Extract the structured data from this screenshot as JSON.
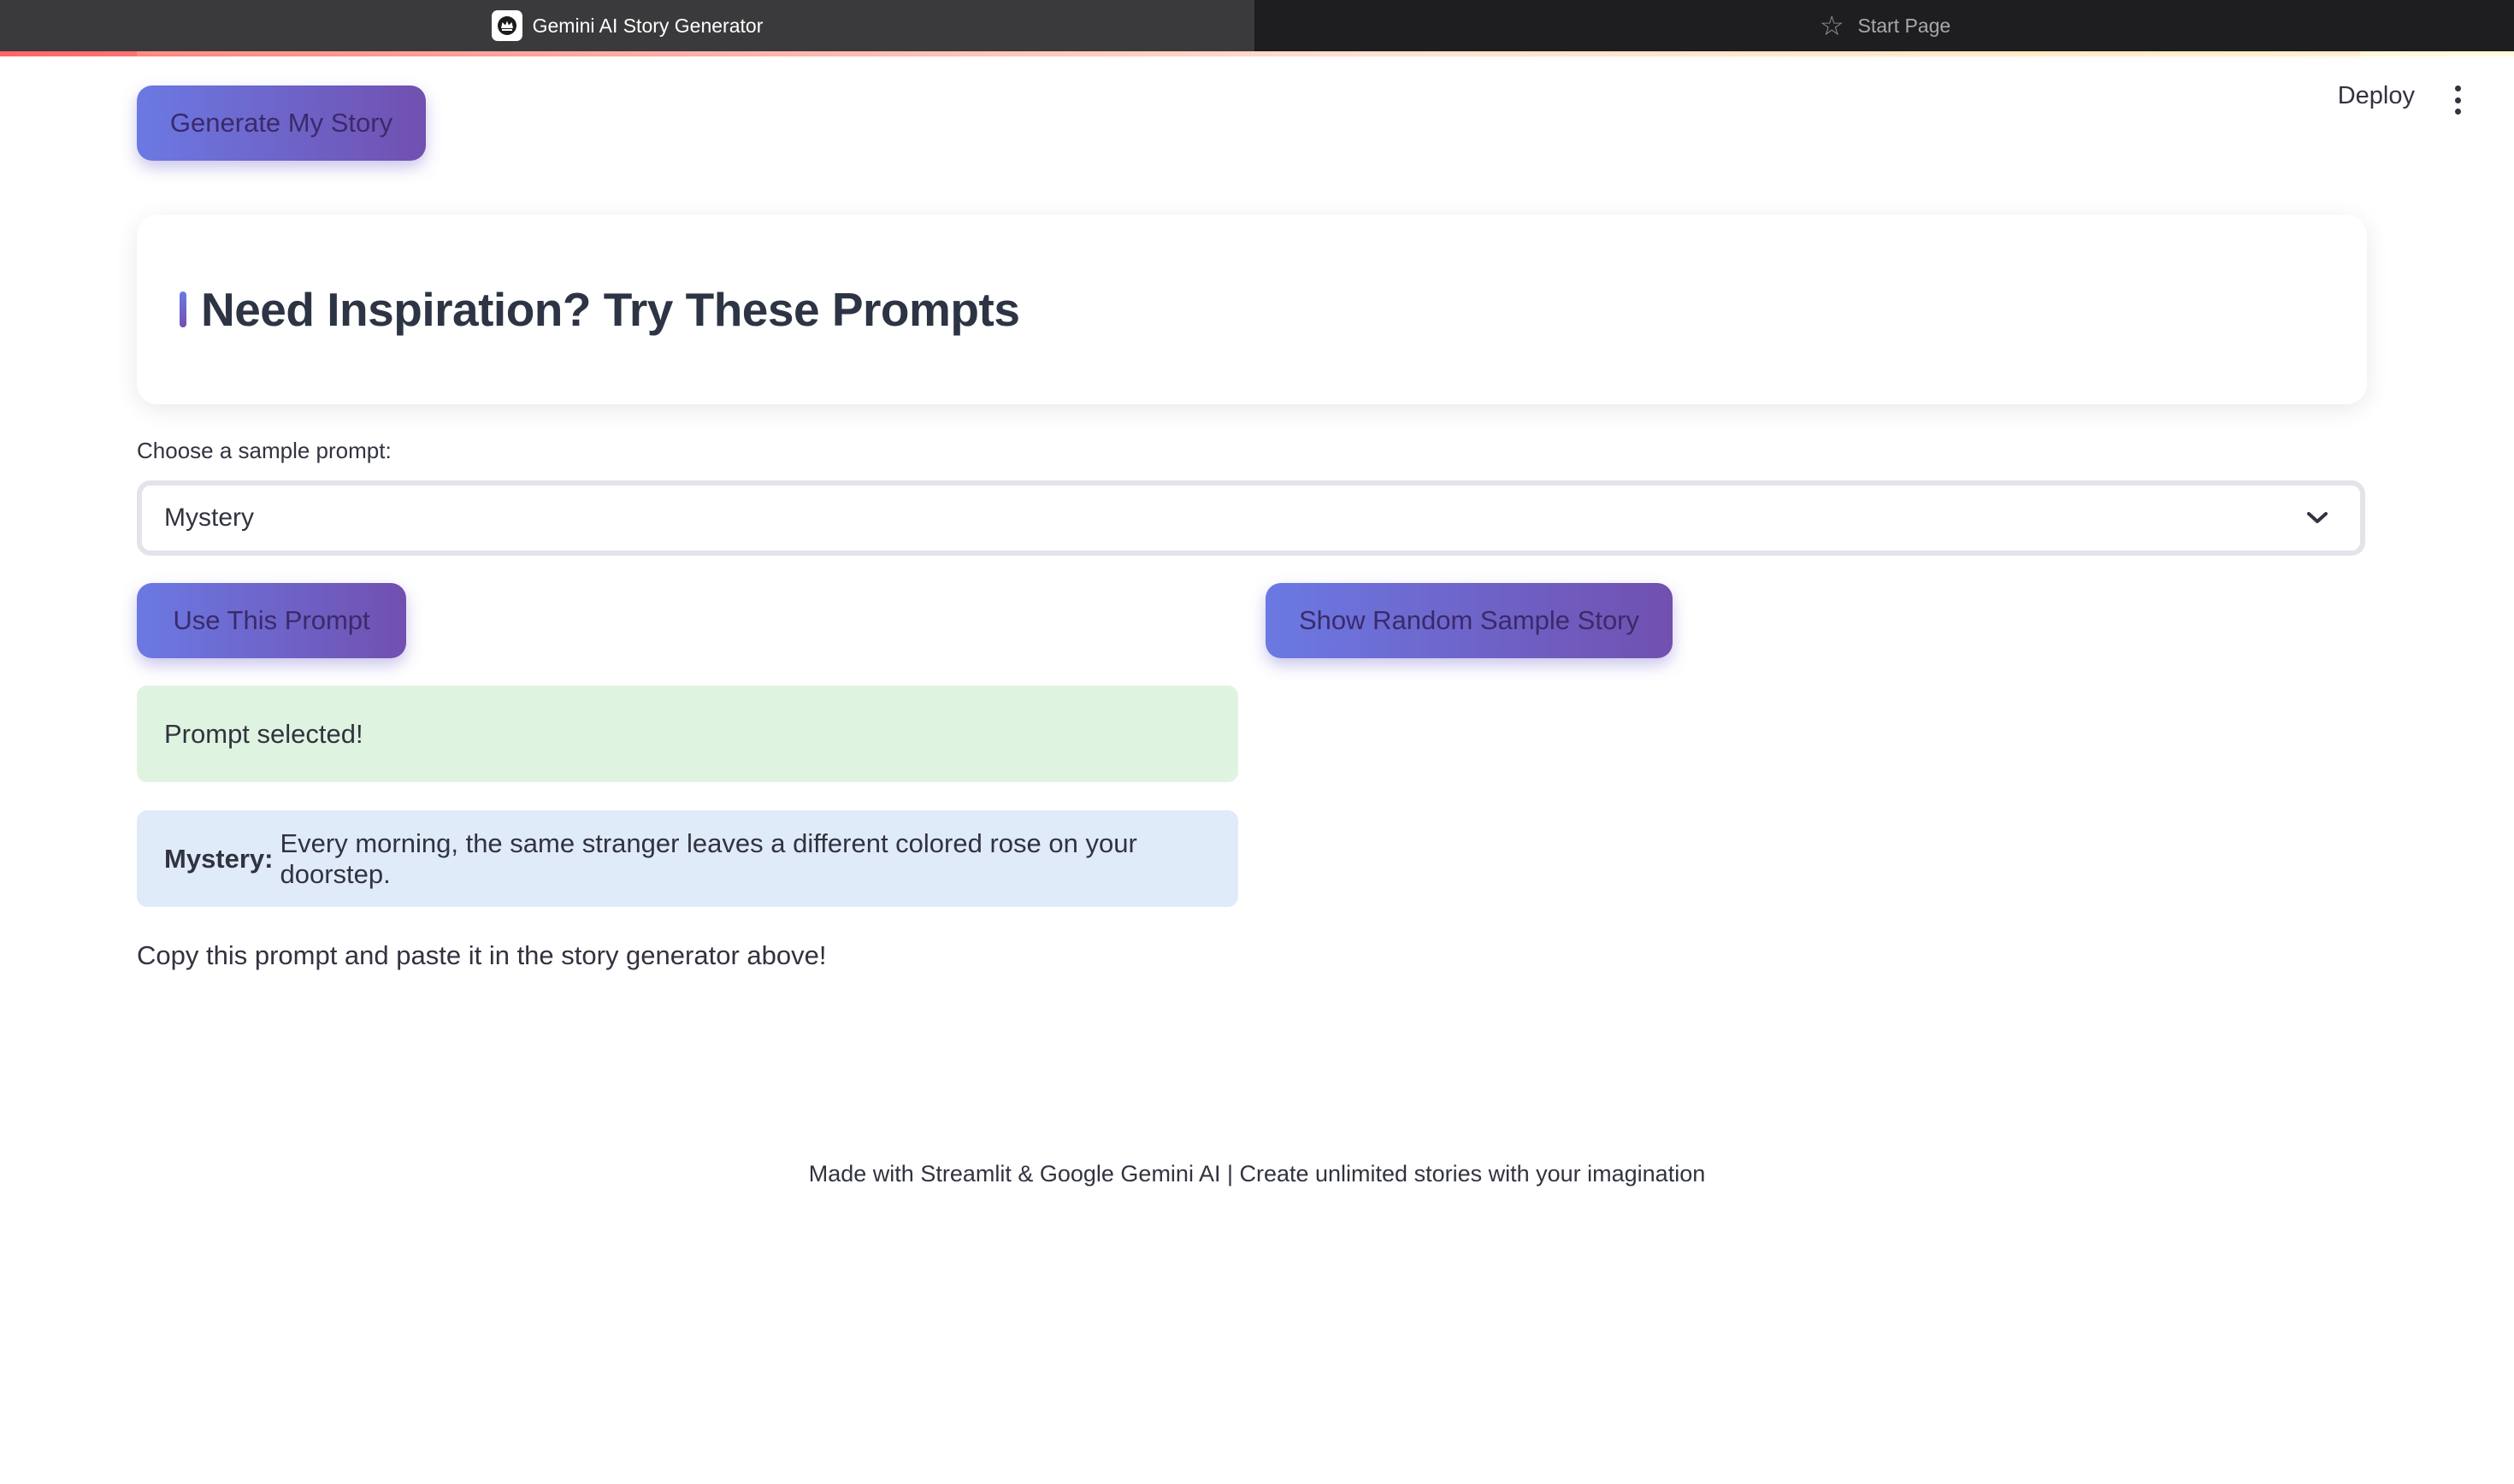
{
  "browser": {
    "tabs": [
      {
        "label": "Gemini AI Story Generator",
        "active": true,
        "icon": "crown-icon"
      },
      {
        "label": "Start Page",
        "active": false,
        "icon": "star-icon"
      }
    ]
  },
  "header": {
    "deploy_label": "Deploy",
    "menu_icon": "kebab-menu-icon"
  },
  "generator": {
    "generate_button_label": "Generate My Story"
  },
  "inspiration": {
    "title": "Need Inspiration? Try These Prompts",
    "select_label": "Choose a sample prompt:",
    "selected_option": "Mystery",
    "use_prompt_label": "Use This Prompt",
    "random_story_label": "Show Random Sample Story",
    "success_message": "Prompt selected!",
    "prompt_genre": "Mystery:",
    "prompt_text": "Every morning, the same stranger leaves a different colored rose on your doorstep.",
    "copy_note": "Copy this prompt and paste it in the story generator above!"
  },
  "footer": {
    "text": "Made with Streamlit & Google Gemini AI | Create unlimited stories with your imagination"
  },
  "colors": {
    "button_gradient_start": "#6b79e3",
    "button_gradient_end": "#7150b0",
    "success_bg": "#dff3e1",
    "info_bg": "#e0ebf9",
    "text": "#31333f"
  }
}
